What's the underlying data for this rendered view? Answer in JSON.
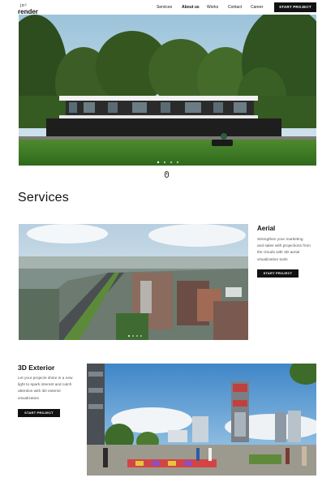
{
  "header": {
    "logo_top": "jɒ²",
    "logo_word": "render",
    "nav": [
      "Services",
      "About us",
      "Works",
      "Contact",
      "Career"
    ],
    "cta_label": "START PROJECT"
  },
  "hero": {
    "slider_dot_count": 4,
    "active_dot": 1
  },
  "services": {
    "title": "Services",
    "aerial": {
      "title": "Aerial",
      "description": "Strengthen ...",
      "lines": [
        "Strengthen your marketing",
        "and sales with projections from",
        "the clouds with 3D aerial",
        "visualization tools"
      ],
      "button": "START PROJECT"
    },
    "exterior": {
      "title": "3D Exterior",
      "lines": [
        "Let your projects shine in a new",
        "light to spark interest and catch",
        "attention with 3D exterior",
        "visualization"
      ],
      "button": "START PROJECT"
    }
  },
  "colors": {
    "accent": "#111111",
    "sky": "#cfe1ec",
    "grass": "#3f7a2a"
  }
}
